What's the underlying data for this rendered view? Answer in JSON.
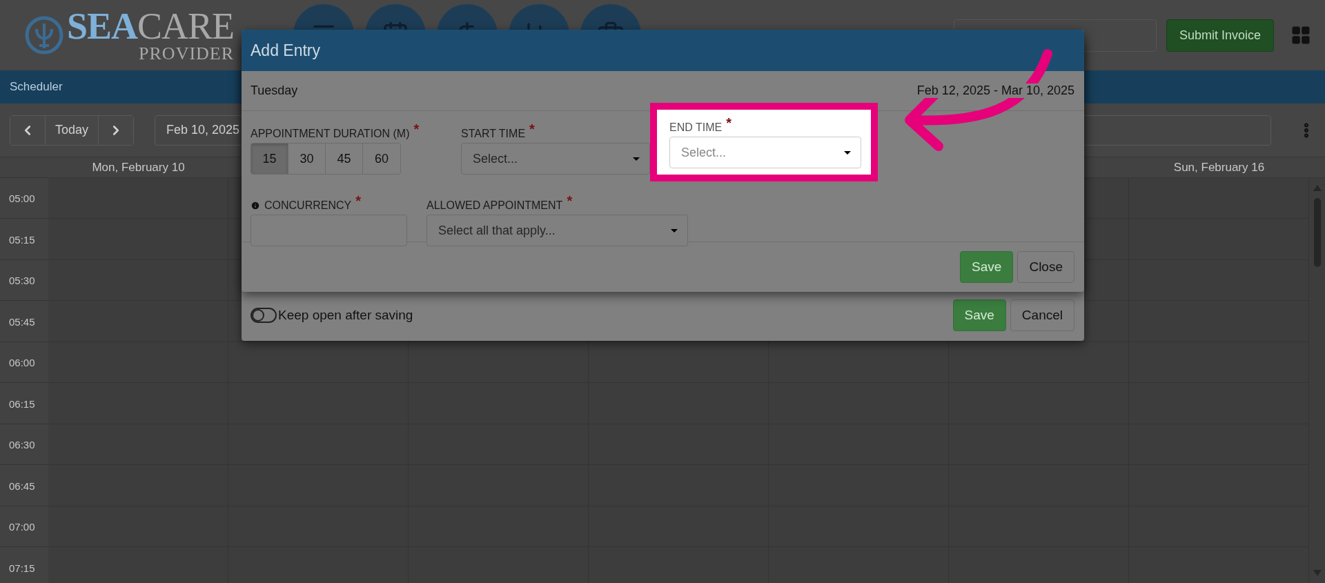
{
  "header": {
    "brand": "**SEA**CARE",
    "brand_sub": "PROVIDER",
    "nav_buttons": [
      {
        "kind": "menu"
      },
      {
        "kind": "calendar"
      },
      {
        "kind": "dollar"
      },
      {
        "kind": "chart"
      },
      {
        "kind": "briefcase"
      }
    ],
    "submit_button": "Submit Invoice"
  },
  "section_title": "Scheduler",
  "toolbar": {
    "today": "Today",
    "date": "Feb 10, 2025"
  },
  "calendar": {
    "first_day": "Mon, February 10",
    "last_day": "Sun, February 16",
    "times": [
      "05:00",
      "05:15",
      "05:30",
      "05:45",
      "06:00",
      "06:15",
      "06:30",
      "06:45",
      "07:00",
      "07:15"
    ]
  },
  "outer_dialog": {
    "keep_open": {
      "label": "Keep open after saving",
      "on": false
    },
    "buttons": [
      {
        "label": "Save",
        "kind": "primary"
      },
      {
        "label": "Cancel",
        "kind": "default"
      }
    ]
  },
  "dialog": {
    "title": "Add Entry",
    "day": "Tuesday",
    "range": "Feb 12, 2025 - Mar 10, 2025",
    "duration": {
      "label": "APPOINTMENT DURATION (M)",
      "mark": "*",
      "options": [
        {
          "label": "15",
          "selected": true
        },
        {
          "label": "30",
          "selected": false
        },
        {
          "label": "45",
          "selected": false
        },
        {
          "label": "60",
          "selected": false
        }
      ]
    },
    "start_time": {
      "label": "START TIME",
      "mark": "*",
      "placeholder": "Select...",
      "highlighted": false
    },
    "end_time": {
      "label": "END TIME",
      "mark": "*",
      "placeholder": "Select...",
      "highlighted": true
    },
    "concurrency": {
      "label": "CONCURRENCY",
      "mark": "*"
    },
    "allowed": {
      "label": "ALLOWED APPOINTMENT",
      "mark": "*",
      "placeholder": "Select all that apply..."
    },
    "buttons": [
      {
        "label": "Save",
        "kind": "primary"
      },
      {
        "label": "Close",
        "kind": "default"
      }
    ]
  }
}
